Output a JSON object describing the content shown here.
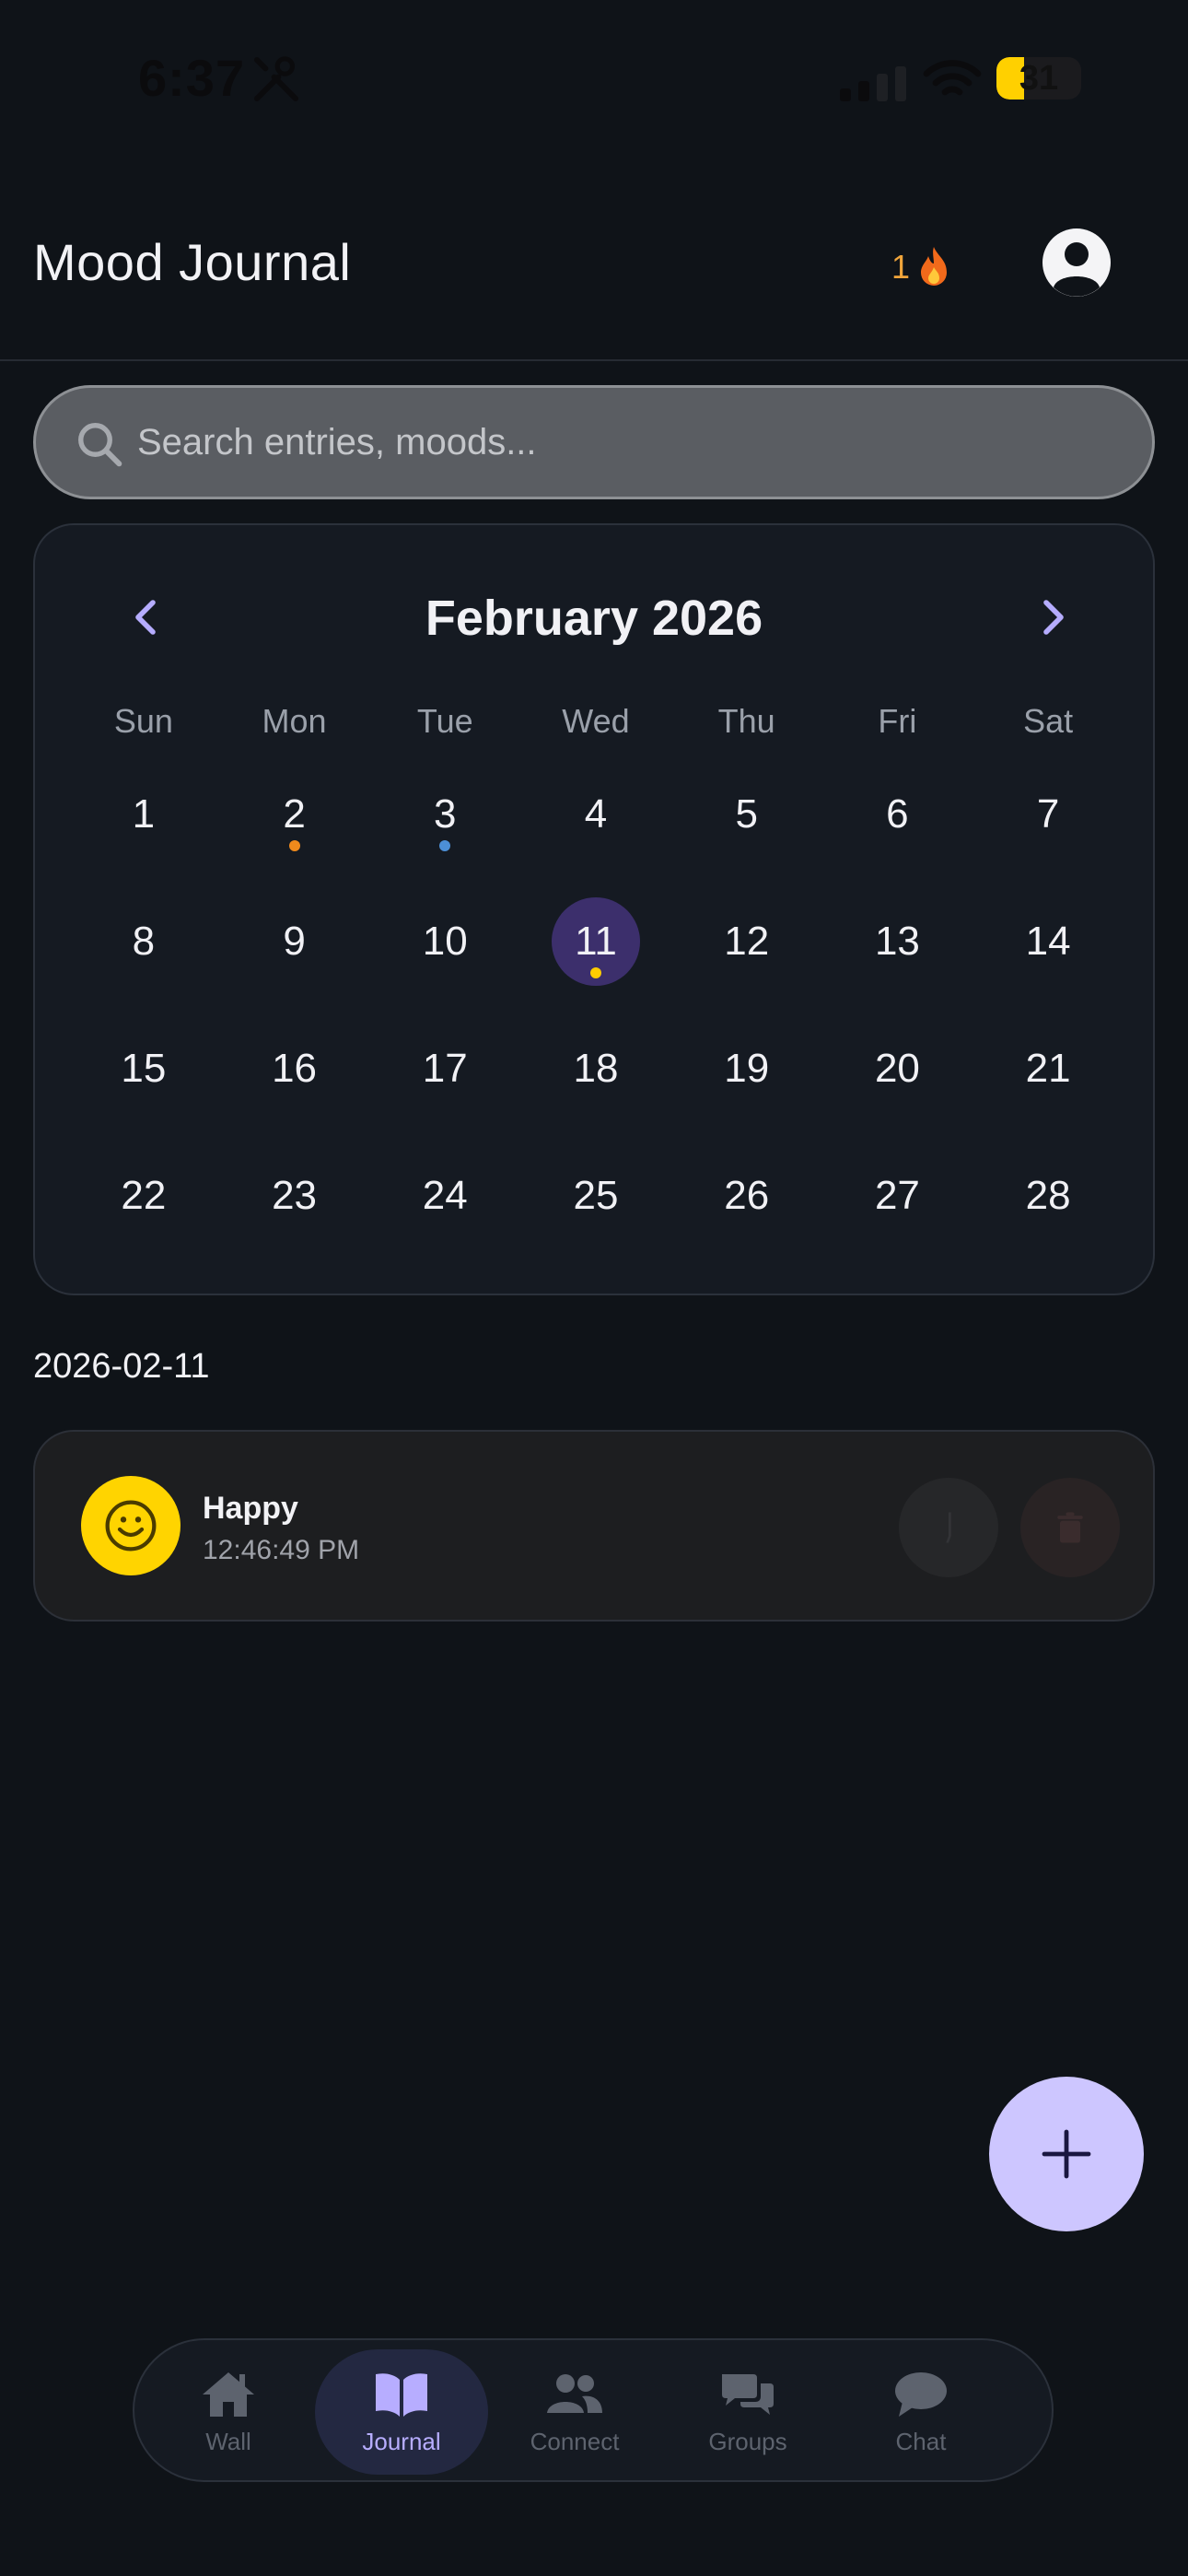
{
  "status_bar": {
    "time": "6:37",
    "battery": "31",
    "tools_icon": "tools-icon",
    "signal_icon": "cellular-signal-icon",
    "wifi_icon": "wifi-icon"
  },
  "header": {
    "title": "Mood Journal",
    "streak_count": "1",
    "streak_icon": "flame-icon",
    "profile_icon": "user-circle-icon"
  },
  "search": {
    "placeholder": "Search entries, moods...",
    "value": ""
  },
  "calendar": {
    "month_label": "February 2026",
    "weekdays": [
      "Sun",
      "Mon",
      "Tue",
      "Wed",
      "Thu",
      "Fri",
      "Sat"
    ],
    "days": [
      "1",
      "2",
      "3",
      "4",
      "5",
      "6",
      "7",
      "8",
      "9",
      "10",
      "11",
      "12",
      "13",
      "14",
      "15",
      "16",
      "17",
      "18",
      "19",
      "20",
      "21",
      "22",
      "23",
      "24",
      "25",
      "26",
      "27",
      "28"
    ],
    "selected_day": "11",
    "mood_dots": {
      "2": "#f08a1c",
      "3": "#4c8fd6",
      "11": "#ffcc00"
    }
  },
  "entries": {
    "date_heading": "2026-02-11",
    "items": [
      {
        "mood": "Happy",
        "time": "12:46:49 PM",
        "icon": "smiley-face-icon",
        "color": "#ffd400"
      }
    ]
  },
  "fab": {
    "icon": "plus-icon"
  },
  "bottom_nav": {
    "active": "Journal",
    "items": [
      {
        "label": "Wall",
        "icon": "home-icon"
      },
      {
        "label": "Journal",
        "icon": "book-open-icon"
      },
      {
        "label": "Connect",
        "icon": "users-icon"
      },
      {
        "label": "Groups",
        "icon": "chat-bubbles-icon"
      },
      {
        "label": "Chat",
        "icon": "chat-bubble-icon"
      }
    ]
  },
  "colors": {
    "background": "#0f1318",
    "card": "#151a22",
    "accent": "#cdc6ff",
    "selected_day": "#3c2f6c",
    "streak": "#f0a53b"
  }
}
